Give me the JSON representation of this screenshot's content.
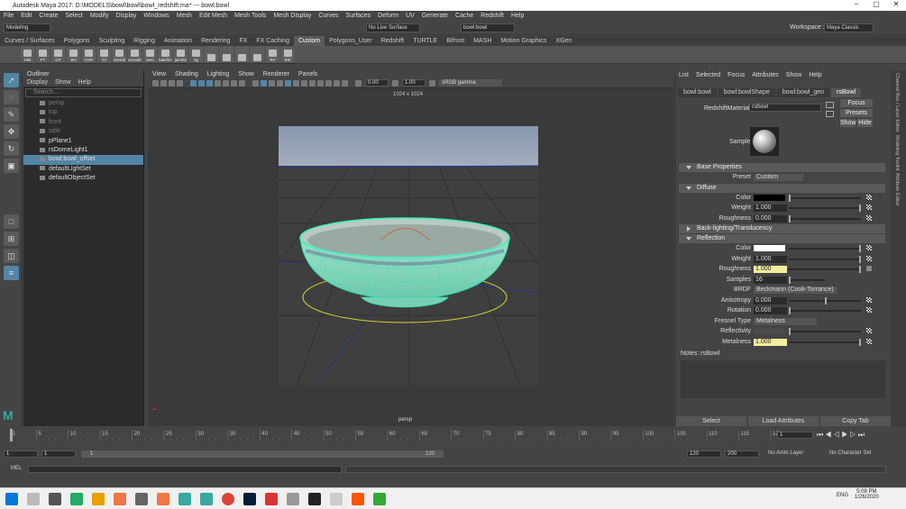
{
  "window": {
    "title": "Autodesk Maya 2017: D:\\MODELS\\bowl\\bowl\\bowl_redshift.ma*  ---  bowl:bowl",
    "workspace_label": "Workspace :",
    "workspace_value": "Maya Classic"
  },
  "menubar": [
    "File",
    "Edit",
    "Create",
    "Select",
    "Modify",
    "Display",
    "Windows",
    "Mesh",
    "Edit Mesh",
    "Mesh Tools",
    "Mesh Display",
    "Curves",
    "Surfaces",
    "Deform",
    "UV",
    "Generate",
    "Cache",
    "Redshift",
    "Help"
  ],
  "statusline": {
    "menuset": "Modeling",
    "live_surface": "No Live Surface",
    "object_field": "bowl:bowl"
  },
  "shelf_tabs": [
    "Curves / Surfaces",
    "Polygons",
    "Sculpting",
    "Rigging",
    "Animation",
    "Rendering",
    "FX",
    "FX Caching",
    "Custom",
    "Polygons_User",
    "Redshift",
    "TURTLE",
    "Bifrost",
    "MASH",
    "Motion Graphics",
    "XGen"
  ],
  "shelf_active": "Custom",
  "shelf_buttons": [
    "Hist",
    "FT",
    "CP",
    "SH",
    "CON",
    "fcl",
    "overidr",
    "smooth",
    "zero",
    "batchIn",
    "jointSz",
    "sg",
    "",
    "",
    "",
    "",
    "RV",
    "EIC"
  ],
  "outliner": {
    "title": "Outliner",
    "menu": [
      "Display",
      "Show",
      "Help"
    ],
    "search_placeholder": "Search...",
    "items": [
      {
        "label": "persp",
        "dim": true
      },
      {
        "label": "top",
        "dim": true
      },
      {
        "label": "front",
        "dim": true
      },
      {
        "label": "side",
        "dim": true
      },
      {
        "label": "pPlane1",
        "dim": false
      },
      {
        "label": "rsDomeLight1",
        "dim": false
      },
      {
        "label": "bowl:bowl_offset",
        "dim": false,
        "selected": true
      },
      {
        "label": "defaultLightSet",
        "dim": false
      },
      {
        "label": "defaultObjectSet",
        "dim": false
      }
    ]
  },
  "viewport": {
    "menu": [
      "View",
      "Shading",
      "Lighting",
      "Show",
      "Renderer",
      "Panels"
    ],
    "exposure": "0.00",
    "gamma": "1.00",
    "colorspace": "sRGB gamma",
    "resolution": "1024 x 1024",
    "camera": "persp"
  },
  "attr_editor": {
    "menu": [
      "List",
      "Selected",
      "Focus",
      "Attributes",
      "Show",
      "Help"
    ],
    "tabs": [
      "bowl:bowl",
      "bowl:bowlShape",
      "bowl:bowl_geo",
      "rsBowl"
    ],
    "active_tab": "rsBowl",
    "material_label": "RedshiftMaterial:",
    "material_name": "rsBowl",
    "focus": "Focus",
    "presets": "Presets",
    "show": "Show",
    "hide": "Hide",
    "sample": "Sample",
    "sections": {
      "base": "Base Properties",
      "diffuse": "Diffuse",
      "backlight": "Back-lighting/Translucency",
      "reflection": "Reflection"
    },
    "preset_label": "Preset",
    "preset_value": "Custom",
    "diffuse": {
      "color_label": "Color",
      "color": "#000000",
      "weight_label": "Weight",
      "weight": "1.000",
      "rough_label": "Roughness",
      "roughness": "0.000"
    },
    "reflection": {
      "color_label": "Color",
      "color": "#ffffff",
      "weight_label": "Weight",
      "weight": "1.000",
      "rough_label": "Roughness",
      "roughness": "1.000",
      "samples_label": "Samples",
      "samples": "16",
      "brdf_label": "BRDF",
      "brdf": "Beckmann (Cook-Torrance)",
      "aniso_label": "Anisotropy",
      "anisotropy": "0.000",
      "rotation_label": "Rotation",
      "rotation": "0.000",
      "fresnel_label": "Fresnel Type",
      "fresnel": "Metalness",
      "refl_label": "Reflectivity",
      "metal_label": "Metalness",
      "metalness": "1.000"
    },
    "notes": "Notes:  rsBowl",
    "buttons": [
      "Select",
      "Load Attributes",
      "Copy Tab"
    ]
  },
  "side_tabs": [
    "Channel Box / Layer Editor",
    "Modeling Toolkit",
    "Attribute Editor"
  ],
  "timeline": {
    "ticks": [
      "1",
      "5",
      "10",
      "15",
      "20",
      "25",
      "30",
      "35",
      "40",
      "45",
      "50",
      "55",
      "60",
      "65",
      "70",
      "75",
      "80",
      "85",
      "90",
      "95",
      "100",
      "105",
      "110",
      "115",
      "120"
    ],
    "current": "1"
  },
  "range": {
    "start": "1",
    "start2": "1",
    "inner_start": "1",
    "inner_end": "120",
    "end": "120",
    "end2": "200",
    "anim_layer": "No Anim Layer",
    "char_set": "No Character Set"
  },
  "cmd": {
    "label": "MEL"
  },
  "taskbar": {
    "time": "5:08 PM",
    "date": "1/26/2020",
    "lang": "ENG"
  }
}
